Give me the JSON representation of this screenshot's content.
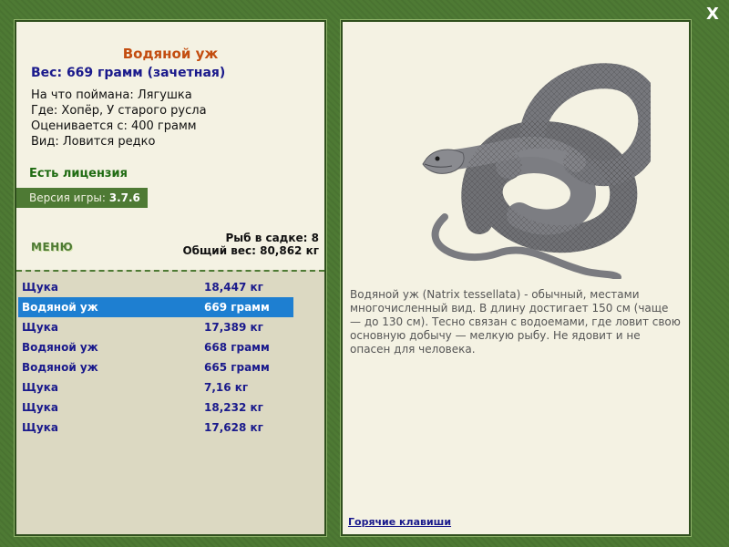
{
  "window": {
    "close_label": "X"
  },
  "fish": {
    "name": "Водяной уж",
    "weight_line": "Вес: 669 грамм (зачетная)",
    "info": [
      "На что поймана: Лягушка",
      "Где: Хопёр, У старого русла",
      "Оценивается с: 400 грамм",
      "Вид: Ловится редко"
    ],
    "license": "Есть лицензия",
    "description": "Водяной уж (Natrix tessellata) - обычный, местами многочисленный вид. В длину достигает 150 см (чаще — до 130 см). Тесно связан с водоемами, где ловит свою основную добычу — мелкую рыбу. Не ядовит и не опасен для человека."
  },
  "game": {
    "version_label": "Версия игры: ",
    "version": "3.7.6"
  },
  "menu": {
    "label": "МЕНЮ"
  },
  "cage": {
    "count_line": "Рыб в садке: 8",
    "total_line": "Общий вес: 80,862 кг"
  },
  "catch_list": [
    {
      "name": "Щука",
      "weight": "18,447 кг",
      "selected": false
    },
    {
      "name": "Водяной уж",
      "weight": "669 грамм",
      "selected": true
    },
    {
      "name": "Щука",
      "weight": "17,389 кг",
      "selected": false
    },
    {
      "name": "Водяной уж",
      "weight": "668 грамм",
      "selected": false
    },
    {
      "name": "Водяной уж",
      "weight": "665 грамм",
      "selected": false
    },
    {
      "name": "Щука",
      "weight": "7,16 кг",
      "selected": false
    },
    {
      "name": "Щука",
      "weight": "18,232 кг",
      "selected": false
    },
    {
      "name": "Щука",
      "weight": "17,628 кг",
      "selected": false
    }
  ],
  "hotkeys": {
    "label": "Горячие клавиши"
  },
  "colors": {
    "background": "#4e7a34",
    "panel": "#f4f2e3",
    "title": "#c34d10",
    "text_blue": "#1a1a8c",
    "selection": "#1e7fd1",
    "license": "#1f6b12"
  }
}
